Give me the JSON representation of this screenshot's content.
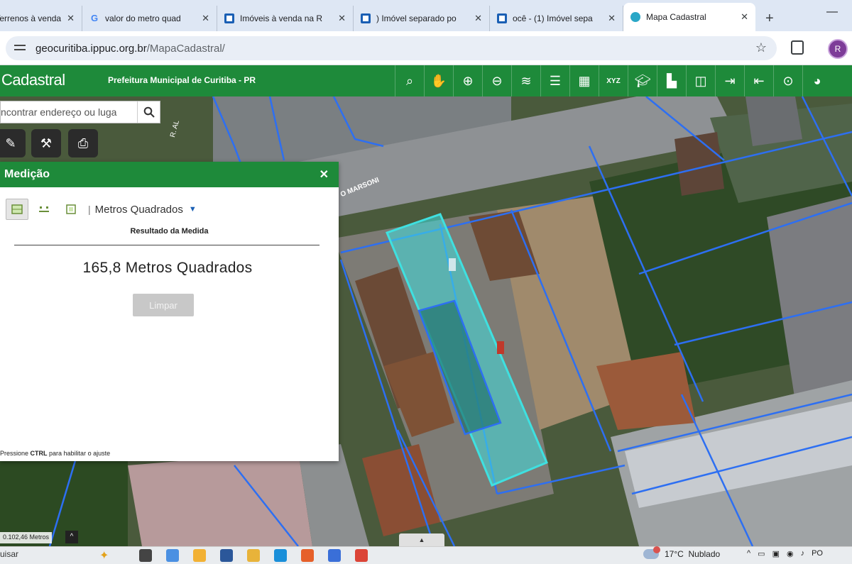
{
  "browser": {
    "tabs": [
      {
        "label": "Terrenos à venda",
        "icon": "house-favicon"
      },
      {
        "label": "valor do metro quad",
        "icon": "google-favicon"
      },
      {
        "label": "Imóveis à venda na R",
        "icon": "site-favicon"
      },
      {
        "label": ") Imóvel separado po",
        "icon": "site-favicon"
      },
      {
        "label": "ocê - (1) Imóvel sepa",
        "icon": "site-favicon"
      },
      {
        "label": "Mapa Cadastral",
        "icon": "map-favicon",
        "active": true
      }
    ],
    "url_host": "geocuritiba.ippuc.org.br",
    "url_path": "/MapaCadastral/",
    "profile_initial": "R"
  },
  "app": {
    "title": "Cadastral",
    "subtitle": "Prefeitura Municipal de Curitiba - PR",
    "toolbar_icons": [
      "identify-icon",
      "pan-hand-icon",
      "zoom-in-icon",
      "zoom-out-icon",
      "layers-icon",
      "list-icon",
      "grid-icon",
      "xyz-coordinates-icon",
      "graduation-icon",
      "building-icon",
      "split-panel-icon",
      "login-icon",
      "logout-icon",
      "target-icon",
      "globe-icon"
    ]
  },
  "map": {
    "search_placeholder": "ncontrar endereço ou luga",
    "street_label_1": "R. AL",
    "street_label_2": "O MARSONI",
    "scale": "0.102,46 Metros",
    "colors": {
      "parcel": "#2d6ff2",
      "selection": "#3fe0e0"
    }
  },
  "measure": {
    "title": "Medição",
    "unit": "Metros Quadrados",
    "result_heading": "Resultado da Medida",
    "result_value": "165,8 Metros Quadrados",
    "clear_label": "Limpar",
    "hint_prefix": "Pressione ",
    "hint_key": "CTRL",
    "hint_suffix": " para habilitar o ajuste"
  },
  "taskbar": {
    "search_text": "uisar",
    "temperature": "17°C",
    "weather": "Nublado",
    "lang": "PO"
  }
}
